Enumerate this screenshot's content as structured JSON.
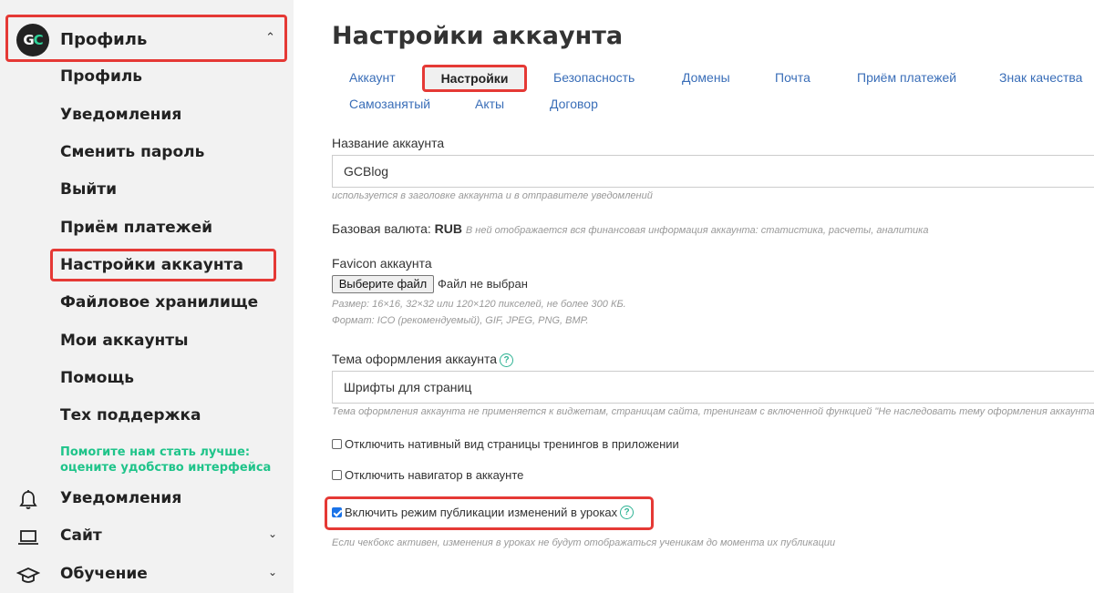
{
  "sidebar": {
    "logo_left": "G",
    "logo_right": "C",
    "header_title": "Профиль",
    "sub_items": [
      "Профиль",
      "Уведомления",
      "Сменить пароль",
      "Выйти",
      "Приём платежей",
      "Настройки аккаунта",
      "Файловое хранилище",
      "Мои аккаунты",
      "Помощь",
      "Тех поддержка"
    ],
    "feedback_line1": "Помогите нам стать лучше:",
    "feedback_line2": "оцените удобство интерфейса",
    "main_items": [
      {
        "label": "Уведомления",
        "icon": "bell-icon"
      },
      {
        "label": "Сайт",
        "icon": "laptop-icon"
      },
      {
        "label": "Обучение",
        "icon": "graduation-cap-icon"
      }
    ]
  },
  "page": {
    "title": "Настройки аккаунта",
    "tabs_row1": [
      "Аккаунт",
      "Настройки",
      "Безопасность",
      "Домены",
      "Почта",
      "Приём платежей",
      "Знак качества"
    ],
    "tabs_row2": [
      "Самозанятый",
      "Акты",
      "Договор"
    ],
    "active_tab": "Настройки"
  },
  "form": {
    "account_name_label": "Название аккаунта",
    "account_name_value": "GCBlog",
    "account_name_hint": "используется в заголовке аккаунта и в отправителе уведомлений",
    "currency_label": "Базовая валюта:",
    "currency_value": "RUB",
    "currency_hint": "В ней отображается вся финансовая информация аккаунта: статистика, расчеты, аналитика",
    "favicon_label": "Favicon аккаунта",
    "file_button": "Выберите файл",
    "file_none": "Файл не выбран",
    "favicon_hint1": "Размер: 16×16, 32×32 или 120×120 пикселей, не более 300 КБ.",
    "favicon_hint2": "Формат: ICO (рекомендуемый), GIF, JPEG, PNG, BMP.",
    "theme_label": "Тема оформления аккаунта",
    "theme_value": "Шрифты для страниц",
    "theme_hint": "Тема оформления аккаунта не применяется к виджетам, страницам сайта, тренингам с включенной функцией \"Не наследовать тему оформления аккаунта",
    "checkbox1": "Отключить нативный вид страницы тренингов в приложении",
    "checkbox2": "Отключить навигатор в аккаунте",
    "checkbox3": "Включить режим публикации изменений в уроках",
    "checkbox3_hint": "Если чекбокс активен, изменения в уроках не будут отображаться ученикам до момента их публикации",
    "help_glyph": "?"
  },
  "colors": {
    "accent_red": "#e53935",
    "link_blue": "#3a6eb8",
    "brand_green": "#1fc48a"
  }
}
